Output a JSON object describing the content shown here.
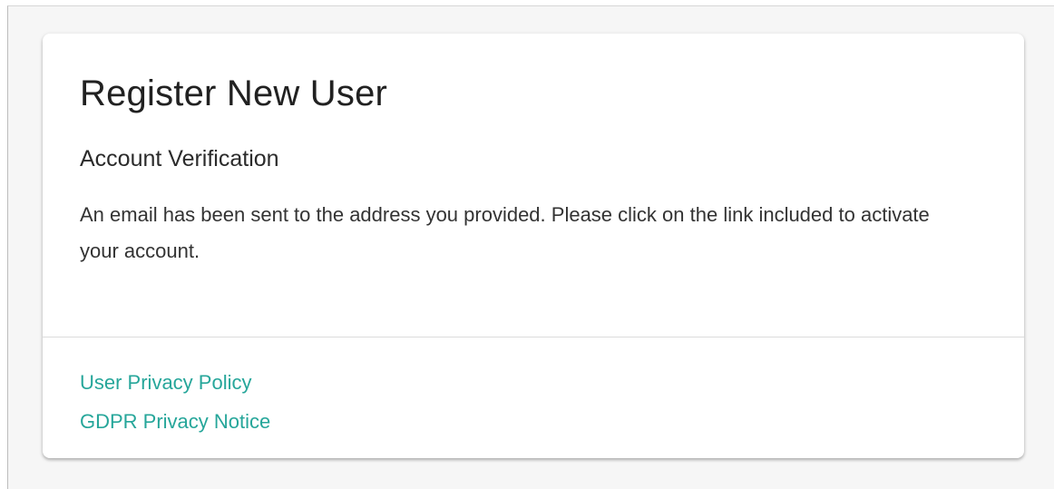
{
  "header": {
    "title": "Register New User"
  },
  "verification": {
    "title": "Account Verification",
    "message": "An email has been sent to the address you provided. Please click on the link included to activate your account."
  },
  "footer": {
    "links": [
      {
        "label": "User Privacy Policy"
      },
      {
        "label": "GDPR Privacy Notice"
      }
    ]
  },
  "colors": {
    "link": "#26a69a",
    "text": "#212121",
    "background": "#f6f6f6",
    "card": "#ffffff"
  }
}
